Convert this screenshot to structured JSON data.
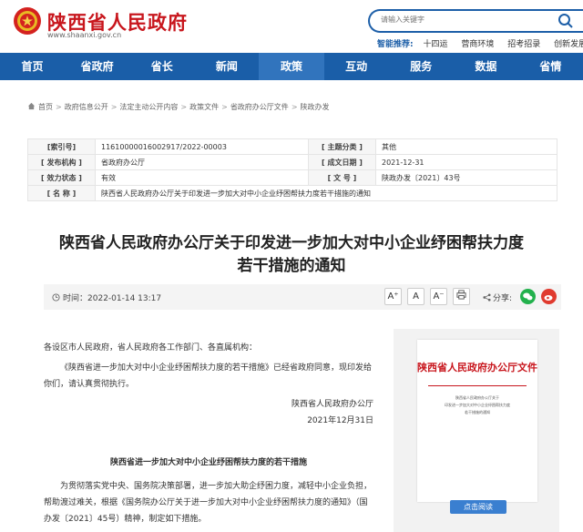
{
  "header": {
    "site_title": "陕西省人民政府",
    "site_domain": "www.shaanxi.gov.cn",
    "search_placeholder": "请输入关键字",
    "smart_label": "智能推荐:",
    "smart_keywords": [
      "十四运",
      "营商环境",
      "招考招录",
      "创新发展"
    ]
  },
  "nav": {
    "items": [
      "首页",
      "省政府",
      "省长",
      "新闻",
      "政策",
      "互动",
      "服务",
      "数据",
      "省情"
    ],
    "active_index": 4
  },
  "breadcrumb": [
    "首页",
    "政府信息公开",
    "法定主动公开内容",
    "政策文件",
    "省政府办公厅文件",
    "陕政办发"
  ],
  "info": {
    "index_label": "[索引号]",
    "index_value": "11610000016002917/2022-00003",
    "topic_label": "[ 主题分类 ]",
    "topic_value": "其他",
    "issuer_label": "[ 发布机构 ]",
    "issuer_value": "省政府办公厅",
    "date_label": "[ 成文日期 ]",
    "date_value": "2021-12-31",
    "status_label": "[ 效力状态 ]",
    "status_value": "有效",
    "docno_label": "[ 文 号 ]",
    "docno_value": "陕政办发〔2021〕43号",
    "name_label": "[ 名 称 ]",
    "name_value": "陕西省人民政府办公厅关于印发进一步加大对中小企业纾困帮扶力度若干措施的通知"
  },
  "doc": {
    "title_line1": "陕西省人民政府办公厅关于印发进一步加大对中小企业纾困帮扶力度",
    "title_line2": "若干措施的通知"
  },
  "toolbar": {
    "time_label": "时间：",
    "time_value": "2022-01-14 13:17",
    "font_inc": "A⁺",
    "font_normal": "A",
    "font_dec": "A⁻",
    "share_label": "分享:"
  },
  "body": {
    "greeting": "各设区市人民政府，省人民政府各工作部门、各直属机构：",
    "para1": "《陕西省进一步加大对中小企业纾困帮扶力度的若干措施》已经省政府同意，现印发给你们，请认真贯彻执行。",
    "signer": "陕西省人民政府办公厅",
    "sign_date": "2021年12月31日",
    "sub_title": "陕西省进一步加大对中小企业纾困帮扶力度的若干措施",
    "para2": "为贯彻落实党中央、国务院决策部署，进一步加大助企纾困力度，减轻中小企业负担，帮助渡过难关，根据《国务院办公厅关于进一步加大对中小企业纾困帮扶力度的通知》（国办发〔2021〕45号）精神，制定如下措施。"
  },
  "sidebar": {
    "thumb_head": "陕西省人民政府办公厅文件",
    "thumb_lines": [
      "陕西省人民政府办公厅关于",
      "印发进一步加大对中小企业纾困帮扶力度",
      "若干措施的通知"
    ],
    "read_button": "点击阅读"
  },
  "colors": {
    "brand_red": "#c8161d",
    "nav_blue": "#1a5ea8",
    "nav_active": "#3174bd",
    "wechat": "#23b14d",
    "weibo": "#e03b2f"
  }
}
